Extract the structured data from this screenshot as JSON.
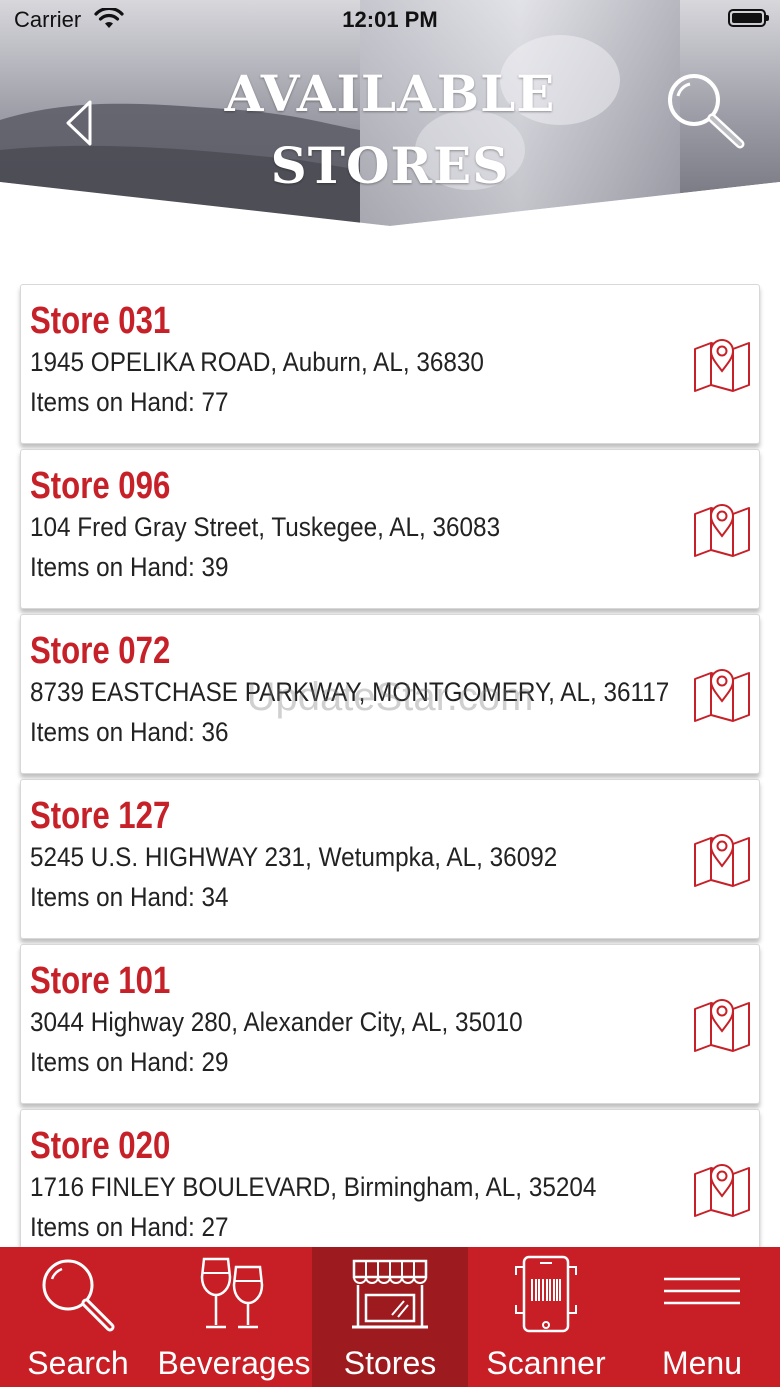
{
  "status_bar": {
    "carrier": "Carrier",
    "time": "12:01 PM"
  },
  "header": {
    "title_line1": "AVAILABLE",
    "title_line2": "STORES"
  },
  "stores": [
    {
      "name": "Store 031",
      "address": "1945 OPELIKA ROAD, Auburn, AL, 36830",
      "items": "Items on Hand: 77"
    },
    {
      "name": "Store 096",
      "address": "104 Fred Gray Street, Tuskegee, AL, 36083",
      "items": "Items on Hand: 39"
    },
    {
      "name": "Store 072",
      "address": "8739 EASTCHASE PARKWAY, MONTGOMERY, AL, 36117",
      "items": "Items on Hand: 36"
    },
    {
      "name": "Store 127",
      "address": "5245 U.S. HIGHWAY 231, Wetumpka, AL, 36092",
      "items": "Items on Hand: 34"
    },
    {
      "name": "Store 101",
      "address": "3044 Highway 280, Alexander City, AL, 35010",
      "items": "Items on Hand: 29"
    },
    {
      "name": "Store 020",
      "address": "1716 FINLEY BOULEVARD, Birmingham, AL, 35204",
      "items": "Items on Hand: 27"
    }
  ],
  "watermark": "UpdateStar.com",
  "tabbar": {
    "tabs": [
      {
        "label": "Search",
        "icon": "search-icon"
      },
      {
        "label": "Beverages",
        "icon": "wine-glasses-icon"
      },
      {
        "label": "Stores",
        "icon": "storefront-icon",
        "active": true
      },
      {
        "label": "Scanner",
        "icon": "barcode-phone-icon"
      },
      {
        "label": "Menu",
        "icon": "hamburger-icon"
      }
    ]
  },
  "colors": {
    "brand_red": "#c81f26",
    "active_tab": "#9d1a1f",
    "store_name": "#c62128"
  }
}
